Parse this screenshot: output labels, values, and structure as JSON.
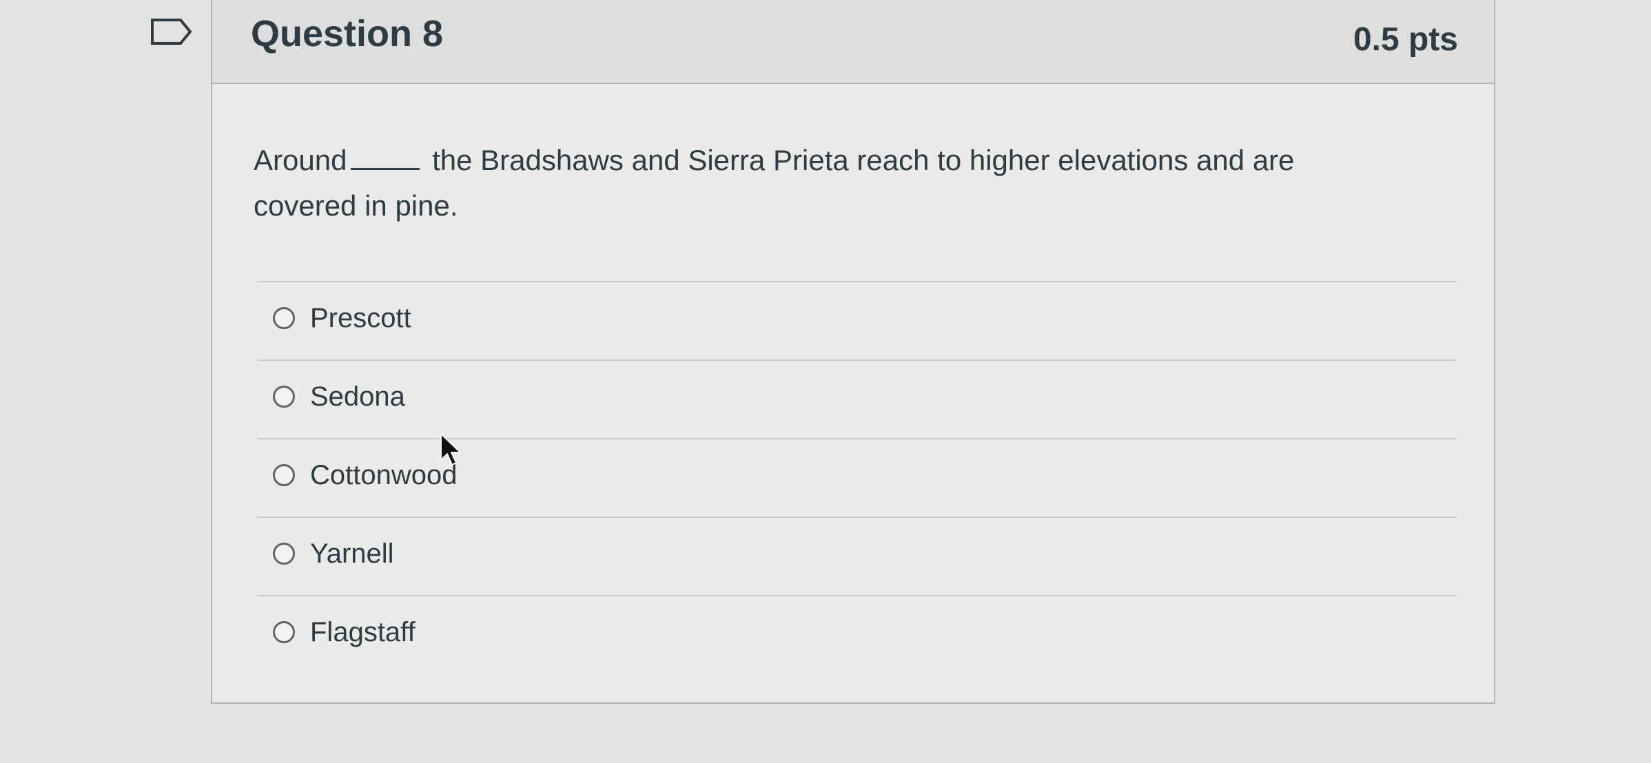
{
  "question": {
    "title": "Question 8",
    "points": "0.5 pts",
    "text_before_blank": "Around",
    "text_after_blank": "the Bradshaws and Sierra Prieta reach to higher elevations and are covered in pine."
  },
  "answers": [
    {
      "label": "Prescott",
      "selected": false
    },
    {
      "label": "Sedona",
      "selected": false
    },
    {
      "label": "Cottonwood",
      "selected": false
    },
    {
      "label": "Yarnell",
      "selected": false
    },
    {
      "label": "Flagstaff",
      "selected": false
    }
  ],
  "icons": {
    "bookmark": "bookmark-flag-icon",
    "cursor": "mouse-pointer-icon"
  },
  "colors": {
    "text": "#2d3b45",
    "header_bg": "#dededc",
    "card_bg": "#eaeae8",
    "border": "#b4b6b6"
  }
}
